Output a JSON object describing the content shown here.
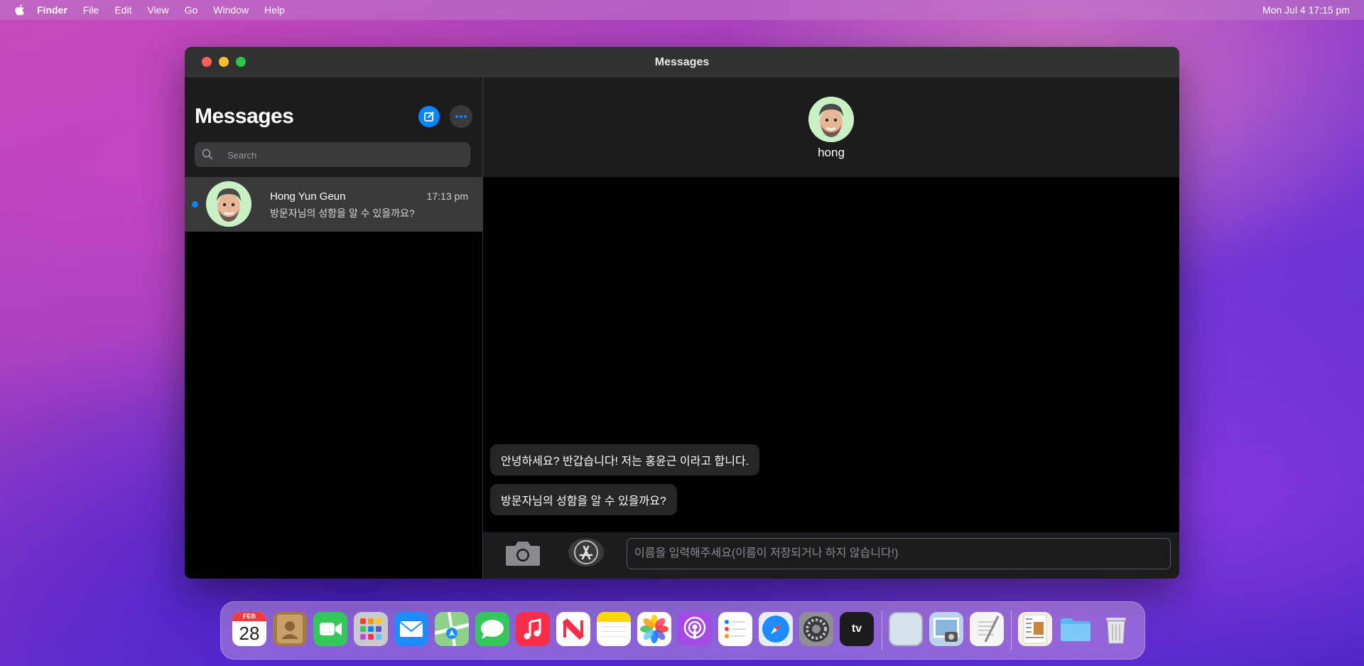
{
  "menubar": {
    "items": [
      "Finder",
      "File",
      "Edit",
      "View",
      "Go",
      "Window",
      "Help"
    ],
    "clock": "Mon  Jul  4  17:15 pm"
  },
  "window": {
    "title": "Messages"
  },
  "sidebar": {
    "title": "Messages",
    "search_placeholder": "Search",
    "conversations": [
      {
        "name": "Hong Yun Geun",
        "time": "17:13  pm",
        "preview": "방문자님의 성함을 알 수 있을까요?",
        "unread": true
      }
    ]
  },
  "chat": {
    "contact": "hong",
    "messages": [
      "안녕하세요? 반갑습니다! 저는 홍윤근 이라고 합니다.",
      "방문자님의 성함을 알 수 있을까요?"
    ],
    "input_placeholder": "이름을 입력해주세요(이름이 저장되거나 하지 않습니다!)"
  },
  "dock": {
    "calendar_month": "FEB",
    "calendar_day": "28",
    "apps": [
      "calendar",
      "contacts",
      "facetime",
      "launchpad",
      "mail",
      "maps",
      "messages",
      "music",
      "news",
      "notes",
      "photos",
      "podcasts",
      "reminders",
      "safari",
      "system-preferences",
      "apple-tv",
      "preview",
      "finder-window",
      "textedit",
      "document",
      "folder",
      "trash"
    ],
    "tv_label": "tv"
  }
}
